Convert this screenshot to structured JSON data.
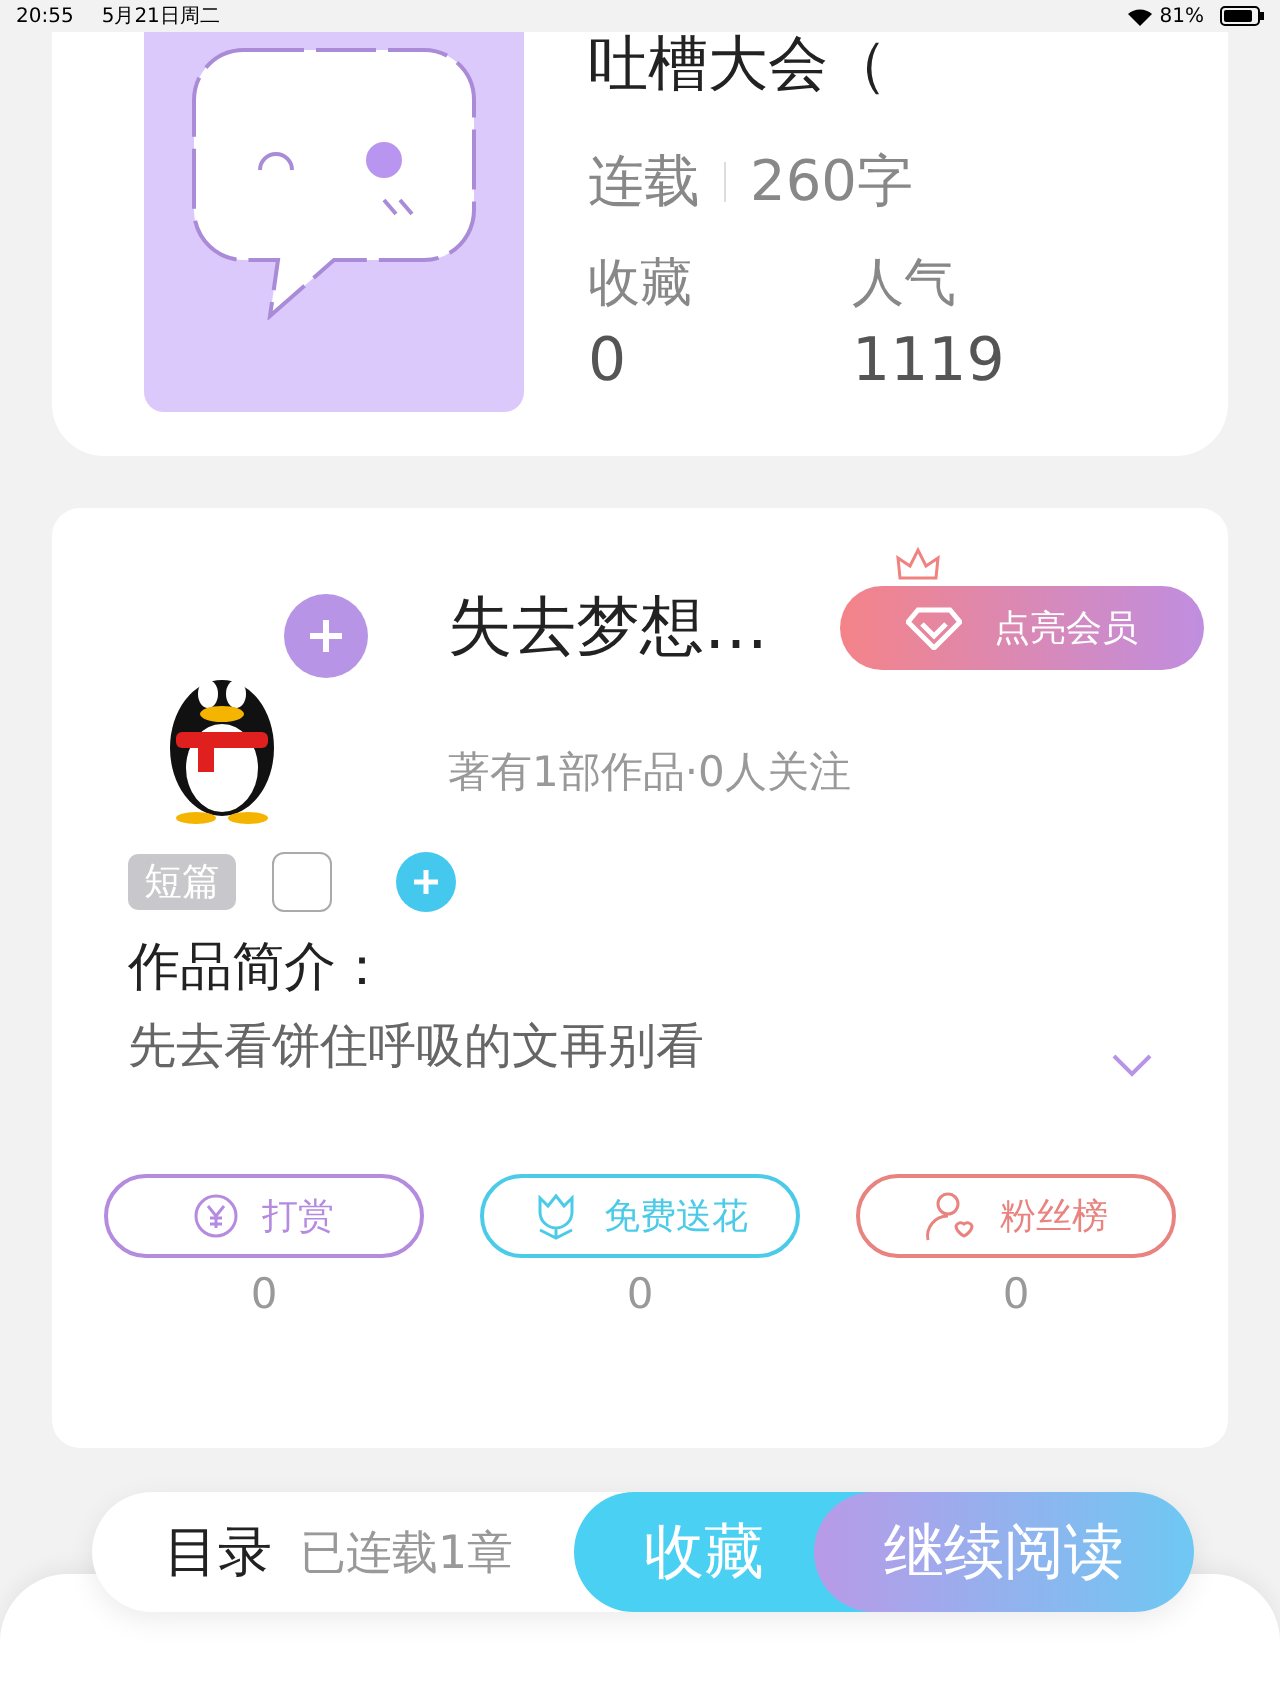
{
  "status_bar": {
    "time": "20:55",
    "date": "5月21日周二",
    "battery": "81%"
  },
  "book": {
    "title": "吐槽大会（",
    "status": "连载",
    "words": "260字",
    "stats": [
      {
        "label": "收藏",
        "value": "0"
      },
      {
        "label": "人气",
        "value": "1119"
      }
    ]
  },
  "author": {
    "name": "失去梦想…",
    "vip_button": "点亮会员",
    "meta": "著有1部作品·0人关注"
  },
  "tags": [
    {
      "kind": "label",
      "text": "短篇"
    },
    {
      "kind": "empty"
    },
    {
      "kind": "add"
    }
  ],
  "intro": {
    "heading": "作品简介：",
    "text": "先去看饼住呼吸的文再别看"
  },
  "actions": [
    {
      "kind": "coin",
      "label": "打赏",
      "count": "0",
      "color": "#b58be0"
    },
    {
      "kind": "flower",
      "label": "免费送花",
      "count": "0",
      "color": "#4ccbe8"
    },
    {
      "kind": "fan",
      "label": "粉丝榜",
      "count": "0",
      "color": "#e8837f"
    }
  ],
  "bottom_bar": {
    "toc": "目录",
    "chapters": "已连载1章",
    "collect_button": "收藏",
    "read_button": "继续阅读"
  }
}
